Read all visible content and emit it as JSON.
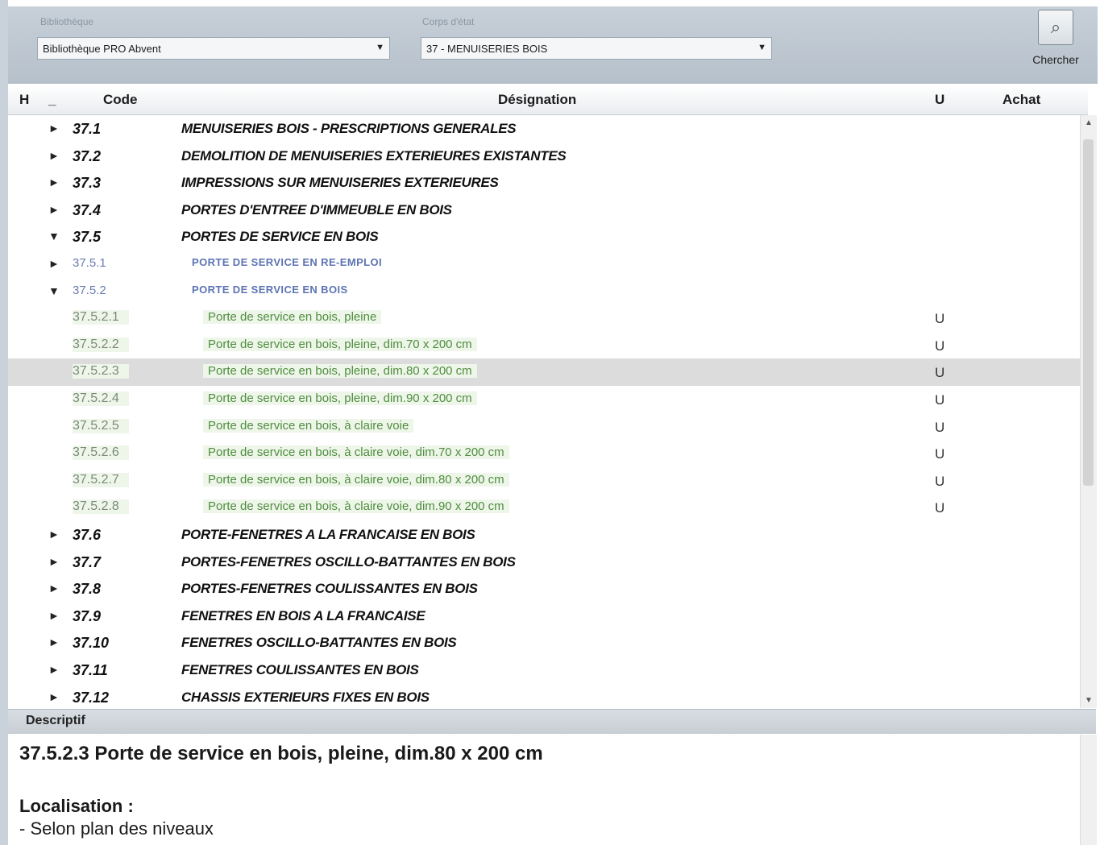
{
  "toolbar": {
    "library_label": "Bibliothèque",
    "library_value": "Bibliothèque PRO Abvent",
    "trade_label": "Corps d'état",
    "trade_value": "37 - MENUISERIES BOIS",
    "search_label": "Chercher",
    "search_icon": "search-icon"
  },
  "columns": {
    "h": "H",
    "collapse": "_",
    "code": "Code",
    "designation": "Désignation",
    "unit": "U",
    "purchase": "Achat"
  },
  "rows": [
    {
      "level": 1,
      "expanded": false,
      "code": "37.1",
      "designation": "MENUISERIES BOIS - PRESCRIPTIONS GENERALES",
      "unit": ""
    },
    {
      "level": 1,
      "expanded": false,
      "code": "37.2",
      "designation": "DEMOLITION DE MENUISERIES EXTERIEURES EXISTANTES",
      "unit": ""
    },
    {
      "level": 1,
      "expanded": false,
      "code": "37.3",
      "designation": "IMPRESSIONS SUR MENUISERIES EXTERIEURES",
      "unit": ""
    },
    {
      "level": 1,
      "expanded": false,
      "code": "37.4",
      "designation": "PORTES D'ENTREE D'IMMEUBLE EN BOIS",
      "unit": ""
    },
    {
      "level": 1,
      "expanded": true,
      "code": "37.5",
      "designation": "PORTES DE SERVICE EN BOIS",
      "unit": ""
    },
    {
      "level": 2,
      "expanded": false,
      "code": "37.5.1",
      "designation": "PORTE DE SERVICE EN RE-EMPLOI",
      "unit": ""
    },
    {
      "level": 2,
      "expanded": true,
      "code": "37.5.2",
      "designation": "PORTE DE SERVICE EN BOIS",
      "unit": ""
    },
    {
      "level": 3,
      "code": "37.5.2.1",
      "designation": "Porte de service en bois, pleine",
      "unit": "U"
    },
    {
      "level": 3,
      "code": "37.5.2.2",
      "designation": "Porte de service en bois, pleine, dim.70 x 200 cm",
      "unit": "U"
    },
    {
      "level": 3,
      "code": "37.5.2.3",
      "designation": "Porte de service en bois, pleine, dim.80 x 200 cm",
      "unit": "U",
      "selected": true
    },
    {
      "level": 3,
      "code": "37.5.2.4",
      "designation": "Porte de service en bois, pleine, dim.90 x 200 cm",
      "unit": "U"
    },
    {
      "level": 3,
      "code": "37.5.2.5",
      "designation": "Porte de service en bois, à claire voie",
      "unit": "U"
    },
    {
      "level": 3,
      "code": "37.5.2.6",
      "designation": "Porte de service en bois, à claire voie, dim.70 x 200 cm",
      "unit": "U"
    },
    {
      "level": 3,
      "code": "37.5.2.7",
      "designation": "Porte de service en bois, à claire voie, dim.80 x 200 cm",
      "unit": "U"
    },
    {
      "level": 3,
      "code": "37.5.2.8",
      "designation": "Porte de service en bois, à claire voie, dim.90 x 200 cm",
      "unit": "U"
    },
    {
      "level": 1,
      "expanded": false,
      "code": "37.6",
      "designation": "PORTE-FENETRES A LA FRANCAISE EN BOIS",
      "unit": ""
    },
    {
      "level": 1,
      "expanded": false,
      "code": "37.7",
      "designation": "PORTES-FENETRES OSCILLO-BATTANTES EN BOIS",
      "unit": ""
    },
    {
      "level": 1,
      "expanded": false,
      "code": "37.8",
      "designation": "PORTES-FENETRES COULISSANTES EN BOIS",
      "unit": ""
    },
    {
      "level": 1,
      "expanded": false,
      "code": "37.9",
      "designation": "FENETRES EN BOIS A LA FRANCAISE",
      "unit": ""
    },
    {
      "level": 1,
      "expanded": false,
      "code": "37.10",
      "designation": "FENETRES OSCILLO-BATTANTES EN BOIS",
      "unit": ""
    },
    {
      "level": 1,
      "expanded": false,
      "code": "37.11",
      "designation": "FENETRES COULISSANTES EN BOIS",
      "unit": ""
    },
    {
      "level": 1,
      "expanded": false,
      "code": "37.12",
      "designation": "CHASSIS EXTERIEURS FIXES EN BOIS",
      "unit": ""
    }
  ],
  "description": {
    "header": "Descriptif",
    "title": "37.5.2.3 Porte de service en bois, pleine, dim.80 x 200 cm",
    "location_label": "Localisation :",
    "location_value": "- Selon plan des niveaux"
  }
}
